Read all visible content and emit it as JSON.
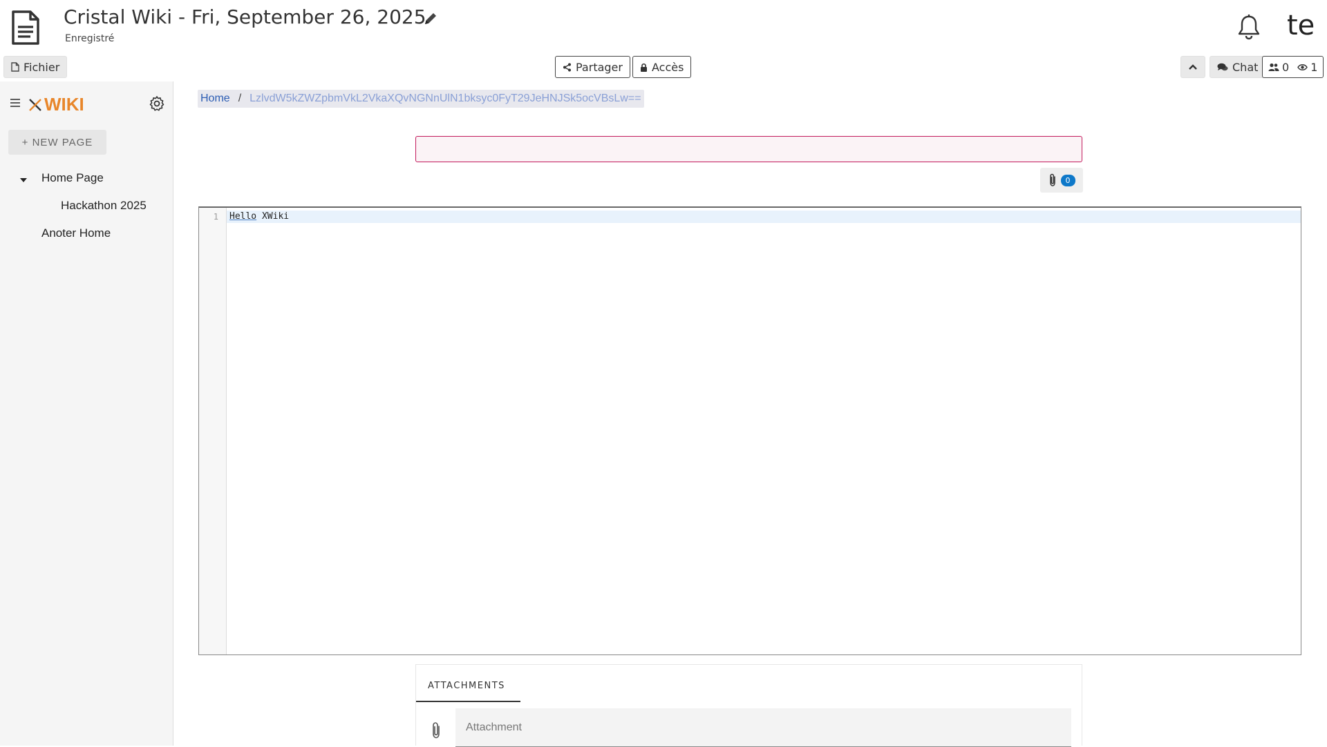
{
  "header": {
    "title": "Cristal Wiki - Fri, September 26, 2025",
    "status": "Enregistré",
    "user_initials": "te"
  },
  "toolbar": {
    "file_label": "Fichier",
    "share_label": "Partager",
    "access_label": "Accès",
    "chat_label": "Chat",
    "users_count": "0",
    "viewers_count": "1"
  },
  "sidebar": {
    "logo_text": "WIKI",
    "new_page_label": "+ NEW PAGE",
    "tree": [
      {
        "label": "Home Page",
        "expanded": true
      },
      {
        "label": "Hackathon 2025"
      },
      {
        "label": "Anoter Home"
      }
    ]
  },
  "breadcrumb": {
    "home": "Home",
    "separator": "/",
    "current": "LzlvdW5kZWZpbmVkL2VkaXQvNGNnUlN1bksyc0FyT29JeHNJSk5ocVBsLw=="
  },
  "editor": {
    "line_number": "1",
    "code_word1": "Hello",
    "code_word2": "XWiki",
    "attachment_count": "0"
  },
  "attachments": {
    "tab_label": "ATTACHMENTS",
    "input_placeholder": "Attachment"
  },
  "colors": {
    "accent": "#e8862a",
    "input_border": "#c2185b",
    "badge": "#0d78c9",
    "link": "#2c5db3"
  }
}
